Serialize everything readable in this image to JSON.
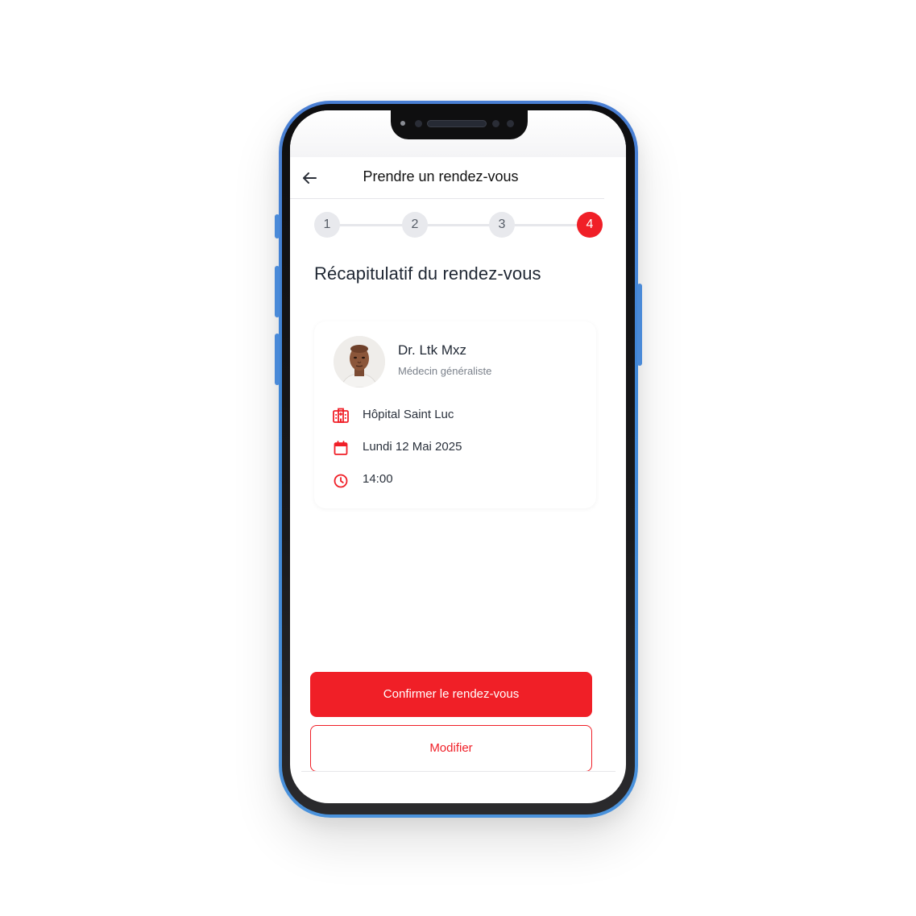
{
  "header": {
    "title": "Prendre un rendez-vous"
  },
  "stepper": {
    "steps": [
      "1",
      "2",
      "3",
      "4"
    ],
    "active_step": "4"
  },
  "page": {
    "title": "Récapitulatif du rendez-vous"
  },
  "doctor": {
    "name": "Dr. Ltk Mxz",
    "specialty": "Médecin généraliste"
  },
  "details": {
    "hospital": "Hôpital Saint Luc",
    "date": "Lundi 12 Mai 2025",
    "time": "14:00"
  },
  "actions": {
    "confirm_label": "Confirmer le rendez-vous",
    "modify_label": "Modifier"
  },
  "colors": {
    "accent": "#f01f27",
    "phone_frame": "#4a7fd4"
  },
  "icons": {
    "back": "arrow-left-icon",
    "hospital": "hospital-icon",
    "date": "calendar-icon",
    "time": "clock-icon"
  }
}
